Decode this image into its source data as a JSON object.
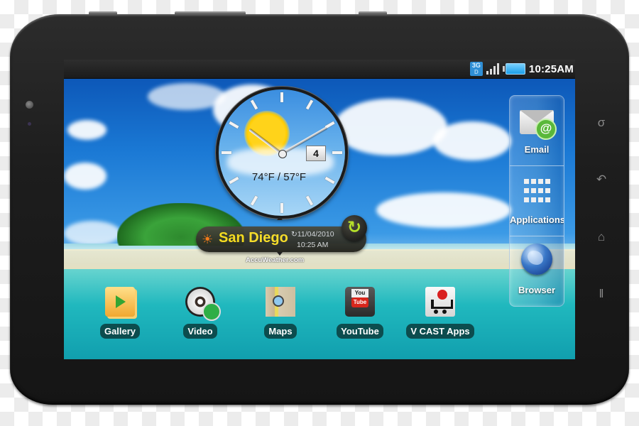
{
  "device": {
    "type": "tablet",
    "hardware_keys": [
      {
        "name": "search",
        "glyph": "σ"
      },
      {
        "name": "back",
        "glyph": "↶"
      },
      {
        "name": "home",
        "glyph": "⌂"
      },
      {
        "name": "menu",
        "glyph": "‖"
      }
    ]
  },
  "status_bar": {
    "network": "3G",
    "network_sub": "D",
    "signal_bars": 4,
    "battery_level": "full",
    "time": "10:25AM"
  },
  "clock_widget": {
    "date_day": "4",
    "temperatures": "74°F / 57°F",
    "hour_hand_deg": 307,
    "minute_hand_deg": 60
  },
  "weather_widget": {
    "weather_icon": "sun-icon",
    "city": "San Diego",
    "update_date": "↻11/04/2010",
    "update_time": "10:25 AM",
    "refresh_icon": "↻",
    "provider": "AccuWeather.com"
  },
  "right_dock": [
    {
      "label": "Email",
      "icon": "email-icon"
    },
    {
      "label": "Applications",
      "icon": "app-grid-icon"
    },
    {
      "label": "Browser",
      "icon": "globe-icon"
    }
  ],
  "home_apps": [
    {
      "label": "Gallery",
      "icon": "gallery-icon"
    },
    {
      "label": "Video",
      "icon": "video-reel-icon"
    },
    {
      "label": "Maps",
      "icon": "map-icon"
    },
    {
      "label": "YouTube",
      "icon": "youtube-icon",
      "icon_text_top": "You",
      "icon_text_bottom": "Tube"
    },
    {
      "label": "V CAST Apps",
      "icon": "shopping-cart-icon"
    }
  ]
}
